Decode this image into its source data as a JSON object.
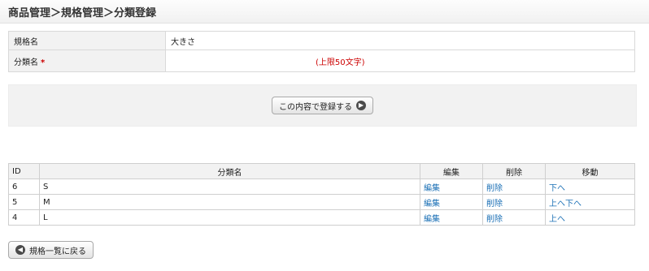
{
  "header": {
    "title": "商品管理＞規格管理＞分類登録"
  },
  "form": {
    "spec_label": "規格名",
    "spec_value": "大きさ",
    "class_label": "分類名",
    "required_mark": "*",
    "class_value": "",
    "limit_note": "(上限50文字)"
  },
  "submit": {
    "label": "この内容で登録する",
    "icon": "arrow-right-icon"
  },
  "list": {
    "headers": {
      "id": "ID",
      "name": "分類名",
      "edit": "編集",
      "delete": "削除",
      "move": "移動"
    },
    "rows": [
      {
        "id": "6",
        "name": "S",
        "edit": "編集",
        "delete": "削除",
        "up": "",
        "down": "下へ"
      },
      {
        "id": "5",
        "name": "M",
        "edit": "編集",
        "delete": "削除",
        "up": "上へ",
        "down": "下へ"
      },
      {
        "id": "4",
        "name": "L",
        "edit": "編集",
        "delete": "削除",
        "up": "上へ",
        "down": ""
      }
    ]
  },
  "back": {
    "label": "規格一覧に戻る",
    "icon": "arrow-left-icon"
  }
}
